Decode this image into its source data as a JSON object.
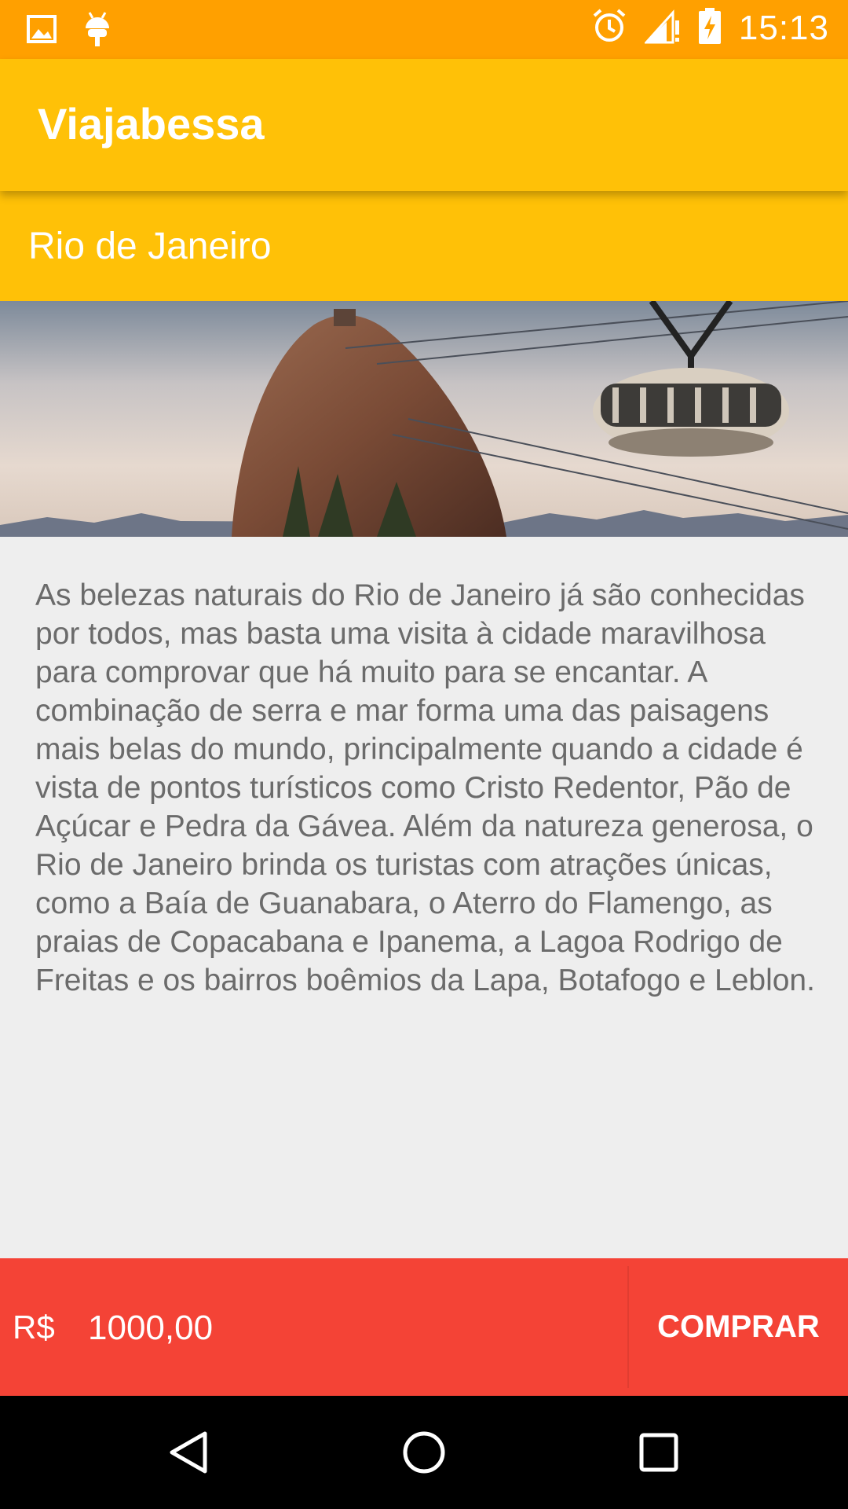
{
  "status_bar": {
    "time": "15:13",
    "icons": [
      "image-icon",
      "android-debug-icon",
      "alarm-icon",
      "signal-icon",
      "battery-charging-icon"
    ]
  },
  "app_bar": {
    "title": "Viajabessa"
  },
  "package": {
    "city": "Rio de Janeiro",
    "description": "As belezas naturais do Rio de Janeiro já são conhecidas por todos, mas basta uma visita à cidade maravilhosa para comprovar que há muito para se encantar. A combinação de serra e mar forma uma das paisagens mais belas do mundo, principalmente quando a cidade é vista de pontos turísticos como Cristo Redentor, Pão de Açúcar e Pedra da Gávea. Além da natureza generosa, o Rio de Janeiro brinda os turistas com atrações únicas, como a Baía de Guanabara, o Aterro do Flamengo, as praias de Copacabana e Ipanema, a Lagoa Rodrigo de Freitas e os bairros boêmios da Lapa, Botafogo e Leblon."
  },
  "purchase_bar": {
    "currency": "R$",
    "price": "1000,00",
    "buy_label": "COMPRAR"
  },
  "nav_bar": {
    "buttons": [
      "back-icon",
      "home-icon",
      "recents-icon"
    ]
  },
  "colors": {
    "status_bar": "#FFA000",
    "primary": "#FFC107",
    "accent": "#F44336",
    "text_body": "#6b6b6b"
  }
}
